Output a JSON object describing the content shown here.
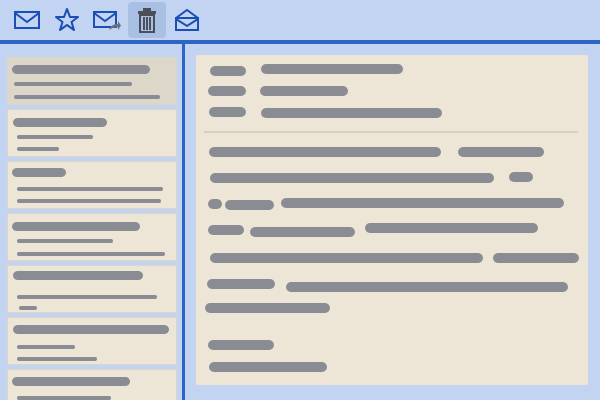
{
  "toolbar": {
    "buttons": [
      {
        "name": "new-mail",
        "icon": "envelope-icon"
      },
      {
        "name": "star",
        "icon": "star-icon"
      },
      {
        "name": "forward",
        "icon": "envelope-forward-icon"
      },
      {
        "name": "delete",
        "icon": "trash-icon",
        "active": true
      },
      {
        "name": "open",
        "icon": "envelope-open-icon"
      }
    ]
  },
  "colors": {
    "background": "#c2d4f2",
    "accent": "#2d65c5",
    "panel": "#ede6d6",
    "placeholder_text": "#8a8c93"
  },
  "message_list": {
    "items": [
      {
        "selected": true
      },
      {
        "selected": false
      },
      {
        "selected": false
      },
      {
        "selected": false
      },
      {
        "selected": false
      },
      {
        "selected": false
      },
      {
        "selected": false
      }
    ]
  }
}
